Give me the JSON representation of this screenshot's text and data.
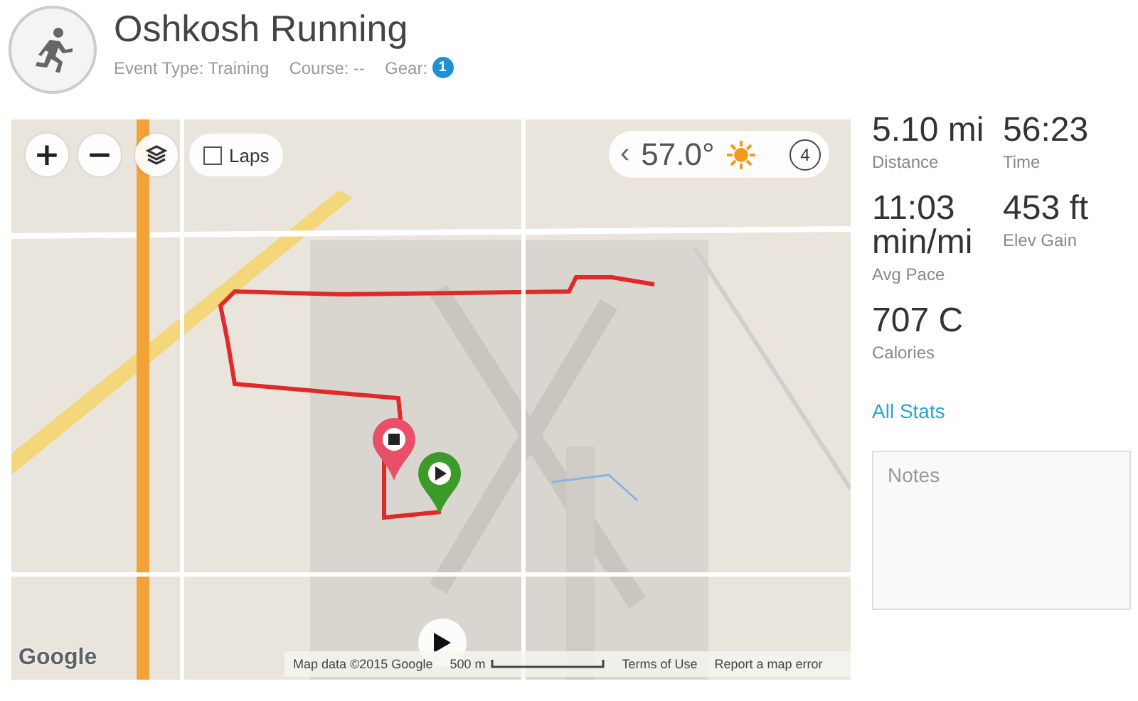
{
  "header": {
    "title": "Oshkosh Running",
    "meta": [
      "Event Type: Training",
      "Course: --"
    ],
    "gear_label": "Gear:",
    "gear_count": "1"
  },
  "map": {
    "zoom_in": "+",
    "zoom_out": "−",
    "laps": {
      "label": "Laps",
      "checked": false
    },
    "weather": {
      "prev": "‹",
      "temperature": "57.0°",
      "lap_count": "4"
    },
    "logo": "Google",
    "attribution": "Map data ©2015 Google",
    "scale": "500 m",
    "links": [
      "Terms of Use",
      "Report a map error"
    ]
  },
  "stats": [
    {
      "value": "5.10 mi",
      "label": "Distance"
    },
    {
      "value": "56:23",
      "label": "Time"
    },
    {
      "value": "11:03 min/mi",
      "label": "Avg Pace"
    },
    {
      "value": "453 ft",
      "label": "Elev Gain"
    },
    {
      "value": "707 C",
      "label": "Calories"
    }
  ],
  "all_stats": "All Stats",
  "notes": {
    "placeholder": "Notes"
  }
}
